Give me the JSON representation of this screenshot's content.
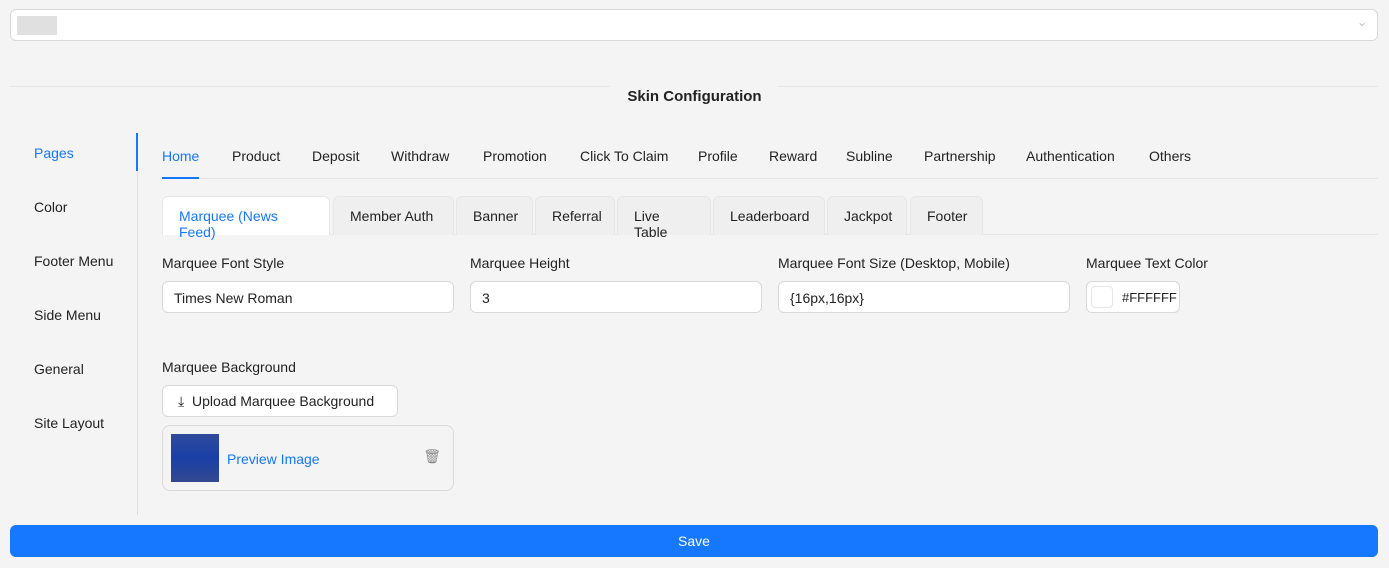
{
  "title": "Skin Configuration",
  "sidebar": [
    "Pages",
    "Color",
    "Footer Menu",
    "Side Menu",
    "General",
    "Site Layout"
  ],
  "tabs": [
    "Home",
    "Product",
    "Deposit",
    "Withdraw",
    "Promotion",
    "Click To Claim",
    "Profile",
    "Reward",
    "Subline",
    "Partnership",
    "Authentication",
    "Others"
  ],
  "subtabs": [
    "Marquee (News Feed)",
    "Member Auth",
    "Banner",
    "Referral",
    "Live Table",
    "Leaderboard",
    "Jackpot",
    "Footer"
  ],
  "fields": {
    "font_style": {
      "label": "Marquee Font Style",
      "value": "Times New Roman"
    },
    "height": {
      "label": "Marquee Height",
      "value": "3"
    },
    "font_size": {
      "label": "Marquee Font Size (Desktop, Mobile)",
      "value": "{16px,16px}"
    },
    "text_color": {
      "label": "Marquee Text Color",
      "value": "#FFFFFF"
    }
  },
  "background": {
    "label": "Marquee Background",
    "upload_label": "Upload Marquee Background",
    "preview_label": "Preview Image"
  },
  "save_label": "Save"
}
